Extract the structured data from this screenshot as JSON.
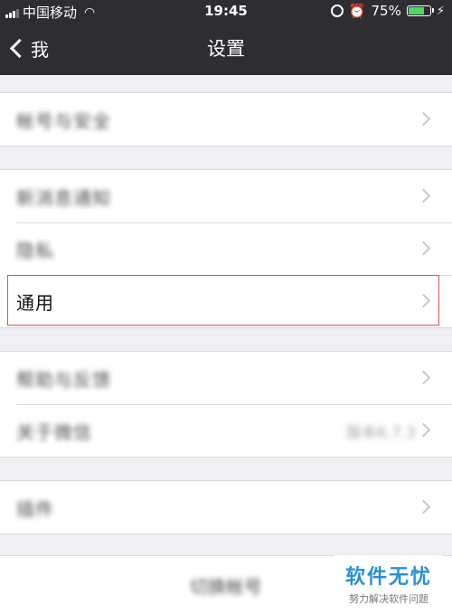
{
  "status_bar": {
    "carrier": "中国移动",
    "time": "19:45",
    "battery_percent": "75%",
    "battery_level": 0.75,
    "battery_color": "#4cd964",
    "icons": [
      "signal-icon",
      "wifi-icon",
      "rotation-lock-icon",
      "alarm-icon",
      "battery-icon",
      "charging-icon"
    ]
  },
  "nav": {
    "back_label": "我",
    "title": "设置"
  },
  "groups": [
    {
      "rows": [
        {
          "label": "帐号与安全",
          "blurred": true
        }
      ]
    },
    {
      "rows": [
        {
          "label": "新消息通知",
          "blurred": true
        },
        {
          "label": "隐私",
          "blurred": true
        },
        {
          "label": "通用",
          "blurred": false,
          "highlighted": true
        }
      ]
    },
    {
      "rows": [
        {
          "label": "帮助与反馈",
          "blurred": true
        },
        {
          "label": "关于微信",
          "blurred": true,
          "value": "版本6.7.3"
        }
      ]
    },
    {
      "rows": [
        {
          "label": "插件",
          "blurred": true
        }
      ]
    }
  ],
  "logout": {
    "label": "切换帐号"
  },
  "watermark": {
    "main": "软件无忧",
    "sub": "努力解决软件问题"
  },
  "colors": {
    "nav_background": "#2e2d32",
    "page_background": "#efeff4",
    "highlight_border": "#d9534f",
    "watermark_text": "#2a8fd6"
  }
}
